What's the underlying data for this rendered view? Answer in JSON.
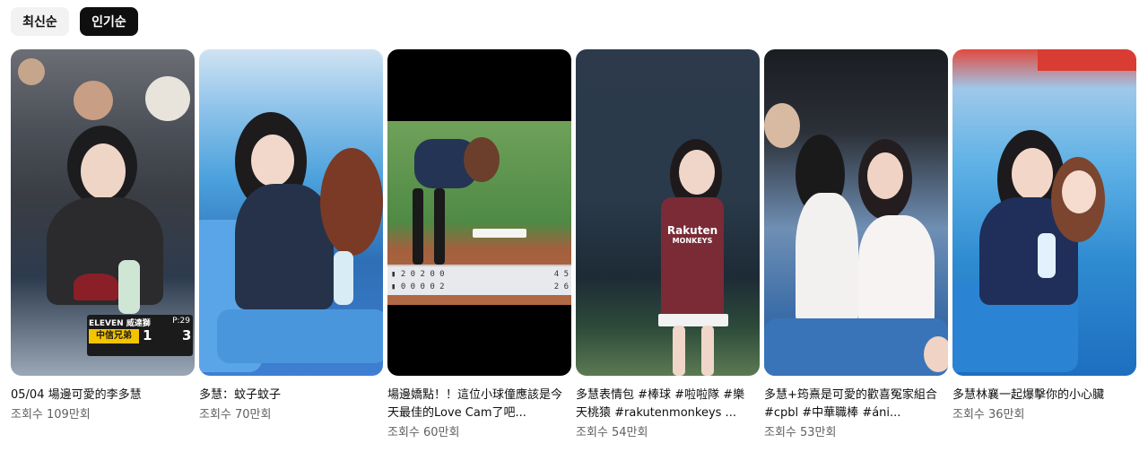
{
  "chips": [
    {
      "label": "최신순",
      "active": false
    },
    {
      "label": "인기순",
      "active": true
    }
  ],
  "videos": [
    {
      "title": "05/04 場邊可愛的李多慧",
      "views": "조회수 109만회",
      "overlay": {
        "team": "中信兄弟",
        "top": "ELEVEN  威達獅",
        "score_a": "1",
        "score_b": "3",
        "pitch": "P:29"
      }
    },
    {
      "title": "多慧：蚊子蚊子",
      "views": "조회수 70만회"
    },
    {
      "title": "場邊嬌點！！這位小球僮應該是今天最佳的Love Cam了吧...",
      "views": "조회수 60만회"
    },
    {
      "title": "多慧表情包 #棒球 #啦啦隊 #樂天桃猿 #rakutenmonkeys ...",
      "views": "조회수 54만회",
      "overlay": {
        "jersey": "Rakuten",
        "jersey_sub": "MONKEYS"
      }
    },
    {
      "title": "多慧+筠熹是可愛的歡喜冤家組合 #cpbl #中華職棒 #áni...",
      "views": "조회수 53만회"
    },
    {
      "title": "多慧林襄一起爆擊你的小心臟",
      "views": "조회수 36만회"
    }
  ]
}
